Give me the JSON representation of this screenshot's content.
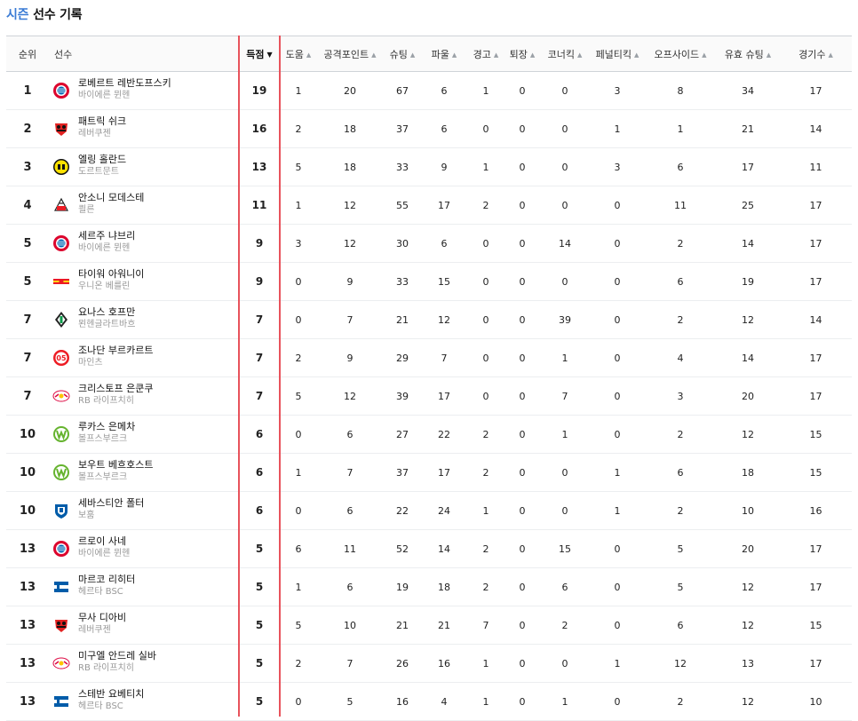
{
  "title": {
    "season": "시즌",
    "rest": "선수 기록"
  },
  "columns": {
    "rank": "순위",
    "player": "선수",
    "goals": "득점",
    "assists": "도움",
    "attack_points": "공격포인트",
    "shots": "슈팅",
    "fouls": "파울",
    "yellow": "경고",
    "red": "퇴장",
    "corners": "코너킥",
    "penalties": "페널티킥",
    "offsides": "오프사이드",
    "shots_on_target": "유효 슈팅",
    "games": "경기수"
  },
  "sort_arrows": {
    "desc": "▼",
    "asc": "▲"
  },
  "rows": [
    {
      "rank": "1",
      "name": "로베르트 레반도프스키",
      "team": "바이에른 뮌헨",
      "logo": "bayern",
      "goals": "19",
      "assists": "1",
      "ap": "20",
      "shots": "67",
      "fouls": "6",
      "yellow": "1",
      "red": "0",
      "corners": "0",
      "pk": "3",
      "offside": "8",
      "sot": "34",
      "games": "17"
    },
    {
      "rank": "2",
      "name": "패트릭 쉬크",
      "team": "레버쿠젠",
      "logo": "leverkusen",
      "goals": "16",
      "assists": "2",
      "ap": "18",
      "shots": "37",
      "fouls": "6",
      "yellow": "0",
      "red": "0",
      "corners": "0",
      "pk": "1",
      "offside": "1",
      "sot": "21",
      "games": "14"
    },
    {
      "rank": "3",
      "name": "엘링 홀란드",
      "team": "도르트문트",
      "logo": "dortmund",
      "goals": "13",
      "assists": "5",
      "ap": "18",
      "shots": "33",
      "fouls": "9",
      "yellow": "1",
      "red": "0",
      "corners": "0",
      "pk": "3",
      "offside": "6",
      "sot": "17",
      "games": "11"
    },
    {
      "rank": "4",
      "name": "안소니 모데스테",
      "team": "쾰른",
      "logo": "koln",
      "goals": "11",
      "assists": "1",
      "ap": "12",
      "shots": "55",
      "fouls": "17",
      "yellow": "2",
      "red": "0",
      "corners": "0",
      "pk": "0",
      "offside": "11",
      "sot": "25",
      "games": "17"
    },
    {
      "rank": "5",
      "name": "세르주 냐브리",
      "team": "바이에른 뮌헨",
      "logo": "bayern",
      "goals": "9",
      "assists": "3",
      "ap": "12",
      "shots": "30",
      "fouls": "6",
      "yellow": "0",
      "red": "0",
      "corners": "14",
      "pk": "0",
      "offside": "2",
      "sot": "14",
      "games": "17"
    },
    {
      "rank": "5",
      "name": "타이워 아워니이",
      "team": "우니온 베를린",
      "logo": "union",
      "goals": "9",
      "assists": "0",
      "ap": "9",
      "shots": "33",
      "fouls": "15",
      "yellow": "0",
      "red": "0",
      "corners": "0",
      "pk": "0",
      "offside": "6",
      "sot": "19",
      "games": "17"
    },
    {
      "rank": "7",
      "name": "요나스 호프만",
      "team": "묀헨글라트바흐",
      "logo": "gladbach",
      "goals": "7",
      "assists": "0",
      "ap": "7",
      "shots": "21",
      "fouls": "12",
      "yellow": "0",
      "red": "0",
      "corners": "39",
      "pk": "0",
      "offside": "2",
      "sot": "12",
      "games": "14"
    },
    {
      "rank": "7",
      "name": "조나단 부르카르트",
      "team": "마인츠",
      "logo": "mainz",
      "goals": "7",
      "assists": "2",
      "ap": "9",
      "shots": "29",
      "fouls": "7",
      "yellow": "0",
      "red": "0",
      "corners": "1",
      "pk": "0",
      "offside": "4",
      "sot": "14",
      "games": "17"
    },
    {
      "rank": "7",
      "name": "크리스토프 은쿤쿠",
      "team": "RB 라이프치히",
      "logo": "leipzig",
      "goals": "7",
      "assists": "5",
      "ap": "12",
      "shots": "39",
      "fouls": "17",
      "yellow": "0",
      "red": "0",
      "corners": "7",
      "pk": "0",
      "offside": "3",
      "sot": "20",
      "games": "17"
    },
    {
      "rank": "10",
      "name": "루카스 은메차",
      "team": "볼프스부르크",
      "logo": "wolfsburg",
      "goals": "6",
      "assists": "0",
      "ap": "6",
      "shots": "27",
      "fouls": "22",
      "yellow": "2",
      "red": "0",
      "corners": "1",
      "pk": "0",
      "offside": "2",
      "sot": "12",
      "games": "15"
    },
    {
      "rank": "10",
      "name": "보우트 베흐호스트",
      "team": "볼프스부르크",
      "logo": "wolfsburg",
      "goals": "6",
      "assists": "1",
      "ap": "7",
      "shots": "37",
      "fouls": "17",
      "yellow": "2",
      "red": "0",
      "corners": "0",
      "pk": "1",
      "offside": "6",
      "sot": "18",
      "games": "15"
    },
    {
      "rank": "10",
      "name": "세바스티안 폴터",
      "team": "보훔",
      "logo": "bochum",
      "goals": "6",
      "assists": "0",
      "ap": "6",
      "shots": "22",
      "fouls": "24",
      "yellow": "1",
      "red": "0",
      "corners": "0",
      "pk": "1",
      "offside": "2",
      "sot": "10",
      "games": "16"
    },
    {
      "rank": "13",
      "name": "르로이 사네",
      "team": "바이에른 뮌헨",
      "logo": "bayern",
      "goals": "5",
      "assists": "6",
      "ap": "11",
      "shots": "52",
      "fouls": "14",
      "yellow": "2",
      "red": "0",
      "corners": "15",
      "pk": "0",
      "offside": "5",
      "sot": "20",
      "games": "17"
    },
    {
      "rank": "13",
      "name": "마르코 리히터",
      "team": "헤르타 BSC",
      "logo": "hertha",
      "goals": "5",
      "assists": "1",
      "ap": "6",
      "shots": "19",
      "fouls": "18",
      "yellow": "2",
      "red": "0",
      "corners": "6",
      "pk": "0",
      "offside": "5",
      "sot": "12",
      "games": "17"
    },
    {
      "rank": "13",
      "name": "무사 디아비",
      "team": "레버쿠젠",
      "logo": "leverkusen",
      "goals": "5",
      "assists": "5",
      "ap": "10",
      "shots": "21",
      "fouls": "21",
      "yellow": "7",
      "red": "0",
      "corners": "2",
      "pk": "0",
      "offside": "6",
      "sot": "12",
      "games": "15"
    },
    {
      "rank": "13",
      "name": "미구엘 안드레 실바",
      "team": "RB 라이프치히",
      "logo": "leipzig",
      "goals": "5",
      "assists": "2",
      "ap": "7",
      "shots": "26",
      "fouls": "16",
      "yellow": "1",
      "red": "0",
      "corners": "0",
      "pk": "1",
      "offside": "12",
      "sot": "13",
      "games": "17"
    },
    {
      "rank": "13",
      "name": "스테반 요베티치",
      "team": "헤르타 BSC",
      "logo": "hertha",
      "goals": "5",
      "assists": "0",
      "ap": "5",
      "shots": "16",
      "fouls": "4",
      "yellow": "1",
      "red": "0",
      "corners": "1",
      "pk": "0",
      "offside": "2",
      "sot": "12",
      "games": "10"
    }
  ]
}
